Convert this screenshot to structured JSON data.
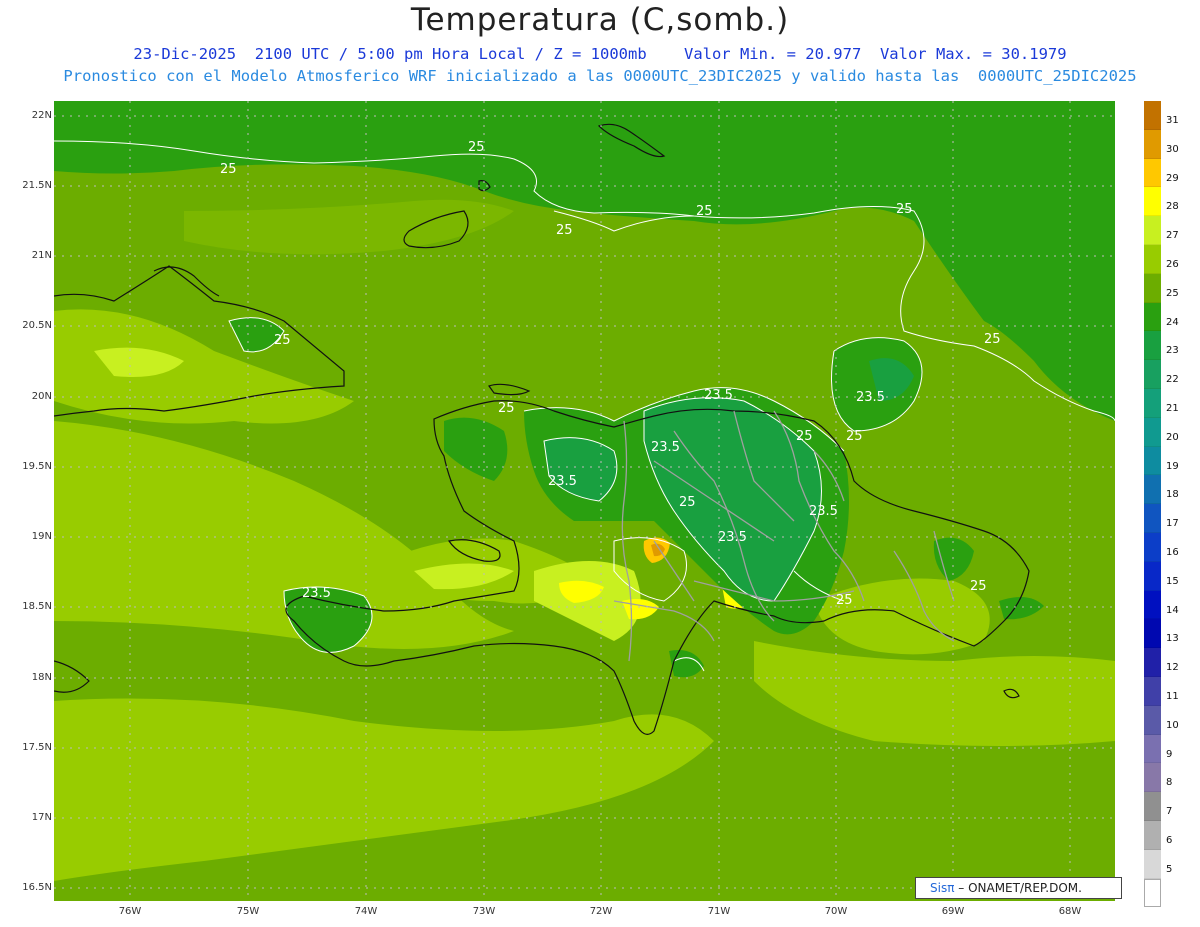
{
  "header": {
    "title": "Temperatura (C,somb.)",
    "line1": "23-Dic-2025  2100 UTC / 5:00 pm Hora Local / Z = 1000mb    Valor Min. = 20.977  Valor Max. = 30.1979",
    "line2": "Pronostico con el Modelo Atmosferico WRF inicializado a las 0000UTC_23DIC2025 y valido hasta las  0000UTC_25DIC2025"
  },
  "axes": {
    "lat_labels": [
      "22N",
      "21.5N",
      "21N",
      "20.5N",
      "20N",
      "19.5N",
      "19N",
      "18.5N",
      "18N",
      "17.5N",
      "17N",
      "16.5N"
    ],
    "lon_labels": [
      "76W",
      "75W",
      "74W",
      "73W",
      "72W",
      "71W",
      "70W",
      "69W",
      "68W"
    ]
  },
  "colorbar": {
    "levels": [
      {
        "label": "31",
        "color": "#c27200"
      },
      {
        "label": "30",
        "color": "#e09a00"
      },
      {
        "label": "29",
        "color": "#ffc800"
      },
      {
        "label": "28",
        "color": "#ffff00"
      },
      {
        "label": "27",
        "color": "#c8f020"
      },
      {
        "label": "26",
        "color": "#98cc00"
      },
      {
        "label": "25",
        "color": "#6cad00"
      },
      {
        "label": "24",
        "color": "#2aa010"
      },
      {
        "label": "23",
        "color": "#19a040"
      },
      {
        "label": "22",
        "color": "#18a060"
      },
      {
        "label": "21",
        "color": "#14a07a"
      },
      {
        "label": "20",
        "color": "#109a90"
      },
      {
        "label": "19",
        "color": "#0e8ca0"
      },
      {
        "label": "18",
        "color": "#1070b0"
      },
      {
        "label": "17",
        "color": "#1055c0"
      },
      {
        "label": "16",
        "color": "#0c3ec8"
      },
      {
        "label": "15",
        "color": "#0828c8"
      },
      {
        "label": "14",
        "color": "#0010c0"
      },
      {
        "label": "13",
        "color": "#0008b0"
      },
      {
        "label": "12",
        "color": "#2020a8"
      },
      {
        "label": "11",
        "color": "#4040a8"
      },
      {
        "label": "10",
        "color": "#5a5aa8"
      },
      {
        "label": "9",
        "color": "#7a70b0"
      },
      {
        "label": "8",
        "color": "#8878a8"
      },
      {
        "label": "7",
        "color": "#909090"
      },
      {
        "label": "6",
        "color": "#b0b0b0"
      },
      {
        "label": "5",
        "color": "#d8d8d8"
      },
      {
        "label": "",
        "color": "#ffffff"
      }
    ]
  },
  "contour_labels": [
    "25",
    "25",
    "25",
    "25",
    "25",
    "25",
    "25",
    "25",
    "25",
    "25",
    "25",
    "25",
    "25",
    "23.5",
    "23.5",
    "23.5",
    "23.5",
    "23.5",
    "23.5",
    "23.5"
  ],
  "credit": {
    "sis": "Sis",
    "pi": "π",
    "rest": " – ONAMET/REP.DOM."
  }
}
